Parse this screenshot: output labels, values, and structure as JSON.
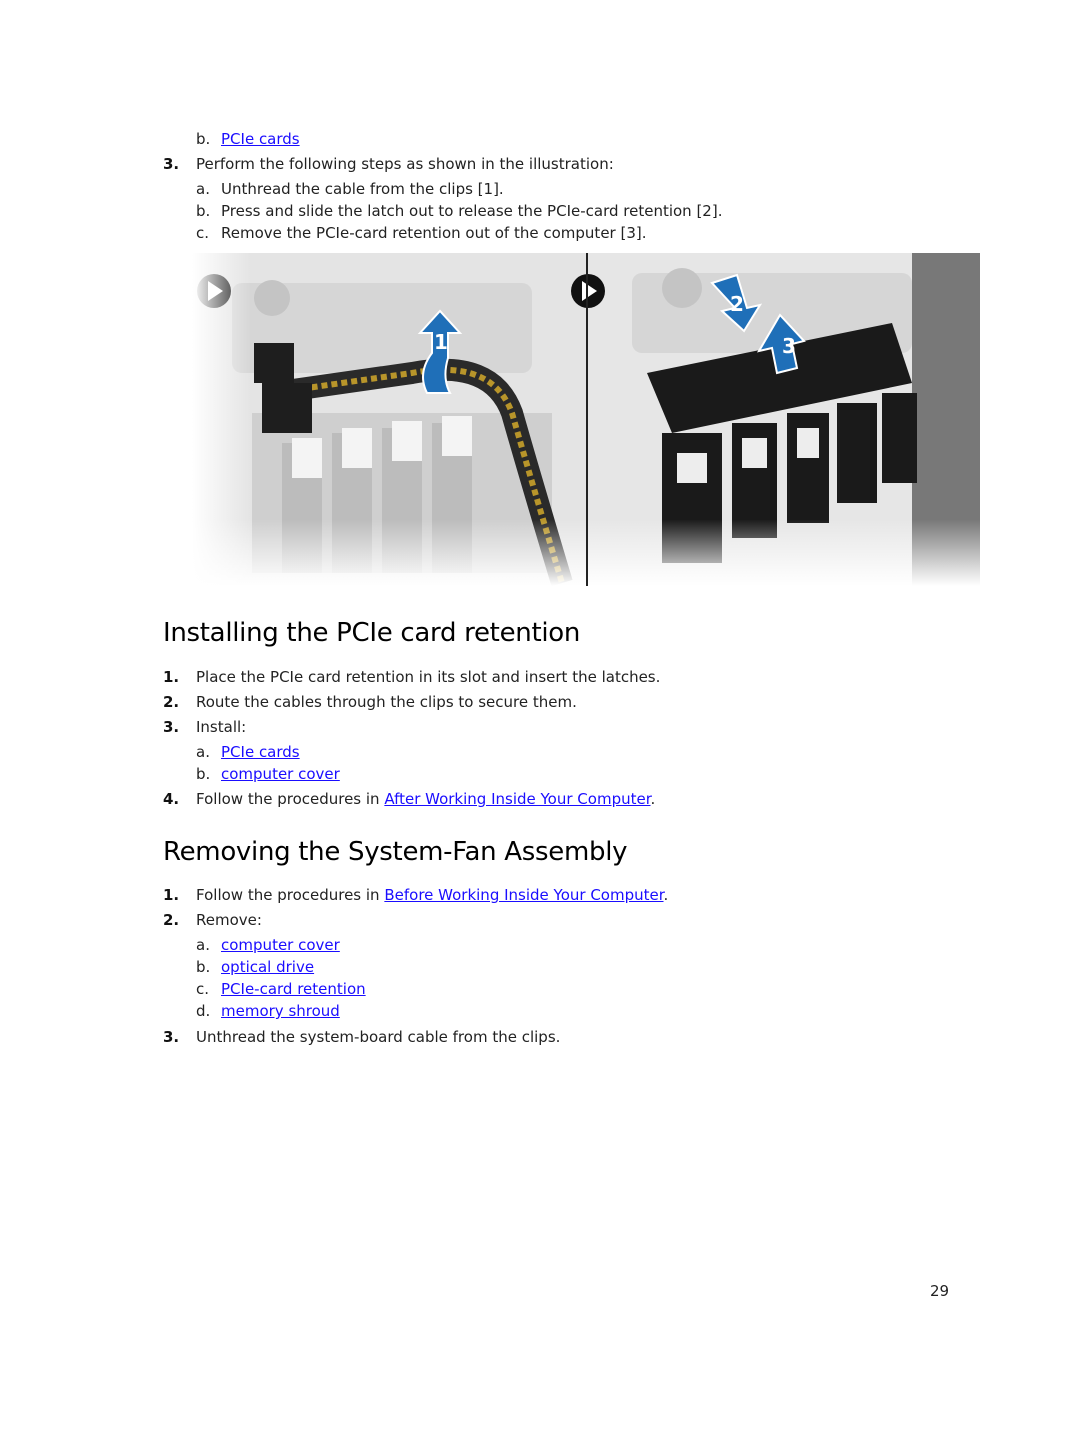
{
  "top_list": {
    "continued_item": {
      "letter": "b.",
      "link": "PCIe cards"
    },
    "step3": {
      "num": "3.",
      "text": "Perform the following steps as shown in the illustration:"
    },
    "substeps": [
      {
        "letter": "a.",
        "text": "Unthread the cable from the clips [1]."
      },
      {
        "letter": "b.",
        "text": "Press and slide the latch out to release the PCIe-card retention [2]."
      },
      {
        "letter": "c.",
        "text": "Remove the PCIe-card retention out of the computer [3]."
      }
    ]
  },
  "illustration": {
    "callouts": [
      "1",
      "2",
      "3"
    ],
    "accent_color": "#1f6fb8",
    "description": "Two-panel illustration: unthreading cable from clips, then pressing latch and lifting PCIe card retention"
  },
  "section_install": {
    "title": "Installing the PCIe card retention",
    "steps": [
      {
        "num": "1.",
        "text": "Place the PCIe card retention in its slot and insert the latches."
      },
      {
        "num": "2.",
        "text": "Route the cables through the clips to secure them."
      },
      {
        "num": "3.",
        "text": "Install:"
      }
    ],
    "install_items": [
      {
        "letter": "a.",
        "link": "PCIe cards"
      },
      {
        "letter": "b.",
        "link": "computer cover"
      }
    ],
    "step4": {
      "num": "4.",
      "prefix": "Follow the procedures in ",
      "link": "After Working Inside Your Computer",
      "suffix": "."
    }
  },
  "section_remove_fan": {
    "title": "Removing the System-Fan Assembly",
    "step1": {
      "num": "1.",
      "prefix": "Follow the procedures in ",
      "link": "Before Working Inside Your Computer",
      "suffix": "."
    },
    "step2": {
      "num": "2.",
      "text": "Remove:"
    },
    "remove_items": [
      {
        "letter": "a.",
        "link": "computer cover"
      },
      {
        "letter": "b.",
        "link": "optical drive"
      },
      {
        "letter": "c.",
        "link": "PCIe-card retention"
      },
      {
        "letter": "d.",
        "link": "memory shroud"
      }
    ],
    "step3": {
      "num": "3.",
      "text": "Unthread the system-board cable from the clips."
    }
  },
  "page_number": "29"
}
